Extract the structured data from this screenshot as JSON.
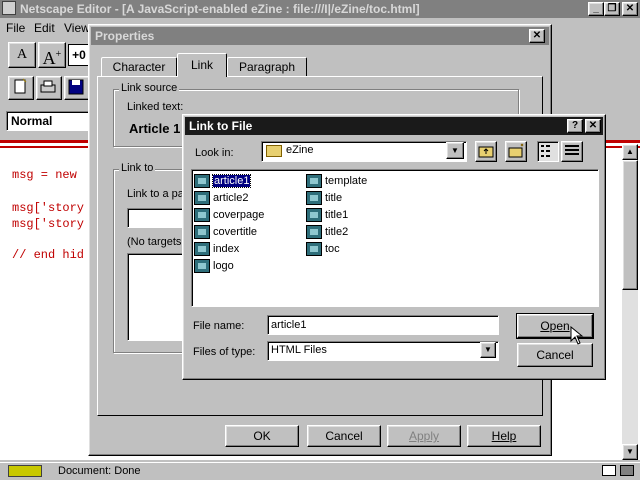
{
  "app": {
    "title": "Netscape Editor - [A JavaScript-enabled eZine : file:///I|/eZine/toc.html]",
    "menu": [
      "File",
      "Edit",
      "View"
    ],
    "font_size_value": "+0",
    "style_value": "Normal",
    "code_lines": [
      "msg = new",
      "msg['story",
      "msg['story",
      "// end hid"
    ],
    "status_text": "Document: Done"
  },
  "properties": {
    "title": "Properties",
    "tabs": [
      "Character",
      "Link",
      "Paragraph"
    ],
    "link_source_label": "Link source",
    "linked_text_label": "Linked text:",
    "linked_text_value": "Article 1",
    "link_to_label": "Link to",
    "link_to_page_label": "Link to a pa",
    "no_targets_label": "(No targets",
    "ok_label": "OK",
    "cancel_label": "Cancel",
    "apply_label": "Apply",
    "help_label": "Help"
  },
  "file_dialog": {
    "title": "Link to File",
    "look_in_label": "Look in:",
    "look_in_value": "eZine",
    "files_col1": [
      "article1",
      "article2",
      "coverpage",
      "covertitle",
      "index",
      "logo"
    ],
    "files_col2": [
      "template",
      "title",
      "title1",
      "title2",
      "toc"
    ],
    "selected_file": "article1",
    "file_name_label": "File name:",
    "file_name_value": "article1",
    "file_type_label": "Files of type:",
    "file_type_value": "HTML Files",
    "open_label": "Open",
    "cancel_label": "Cancel"
  },
  "colors": {
    "title_inactive": "#808080",
    "title_active": "#000080",
    "dialog_titlebar": "#1a1a1a",
    "code_red": "#c00000"
  }
}
